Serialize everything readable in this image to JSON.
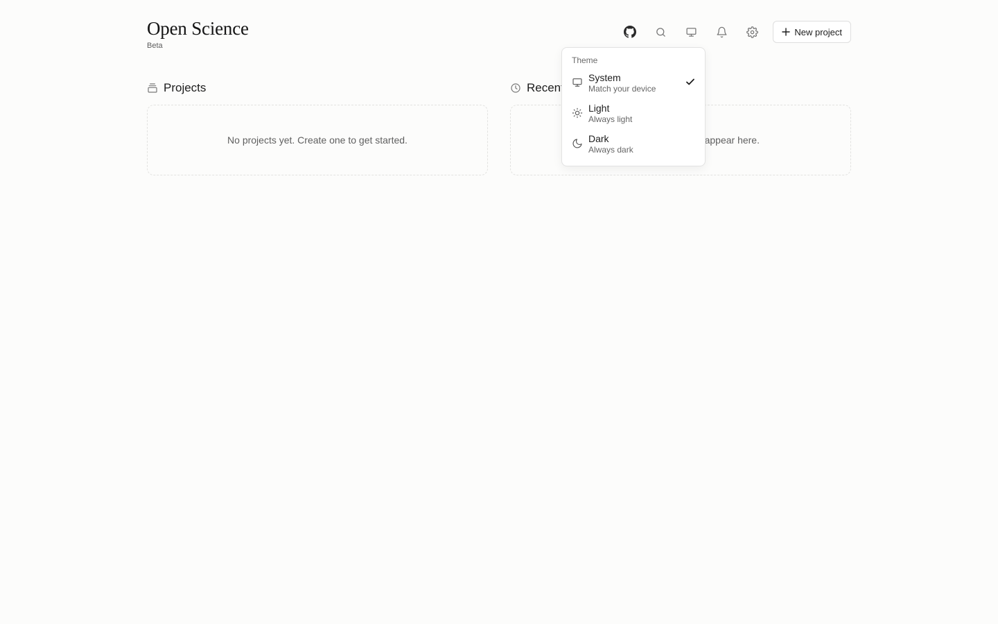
{
  "brand": {
    "title": "Open Science",
    "subtitle": "Beta"
  },
  "toolbar": {
    "icons": [
      "github-icon",
      "search-icon",
      "monitor-icon",
      "bell-icon",
      "gear-icon"
    ],
    "new_project_label": "New project"
  },
  "sections": {
    "projects": {
      "title": "Projects",
      "empty_text": "No projects yet. Create one to get started."
    },
    "recent": {
      "title": "Recent",
      "empty_text": "appear here."
    }
  },
  "theme_menu": {
    "label": "Theme",
    "selected": "System",
    "options": [
      {
        "name": "System",
        "description": "Match your device",
        "icon": "monitor-icon"
      },
      {
        "name": "Light",
        "description": "Always light",
        "icon": "sun-icon"
      },
      {
        "name": "Dark",
        "description": "Always dark",
        "icon": "moon-icon"
      }
    ]
  },
  "colors": {
    "background": "#fcfcfb",
    "text": "#1c1c1c",
    "muted": "#5f5f5f",
    "border": "#e2e2e0"
  }
}
